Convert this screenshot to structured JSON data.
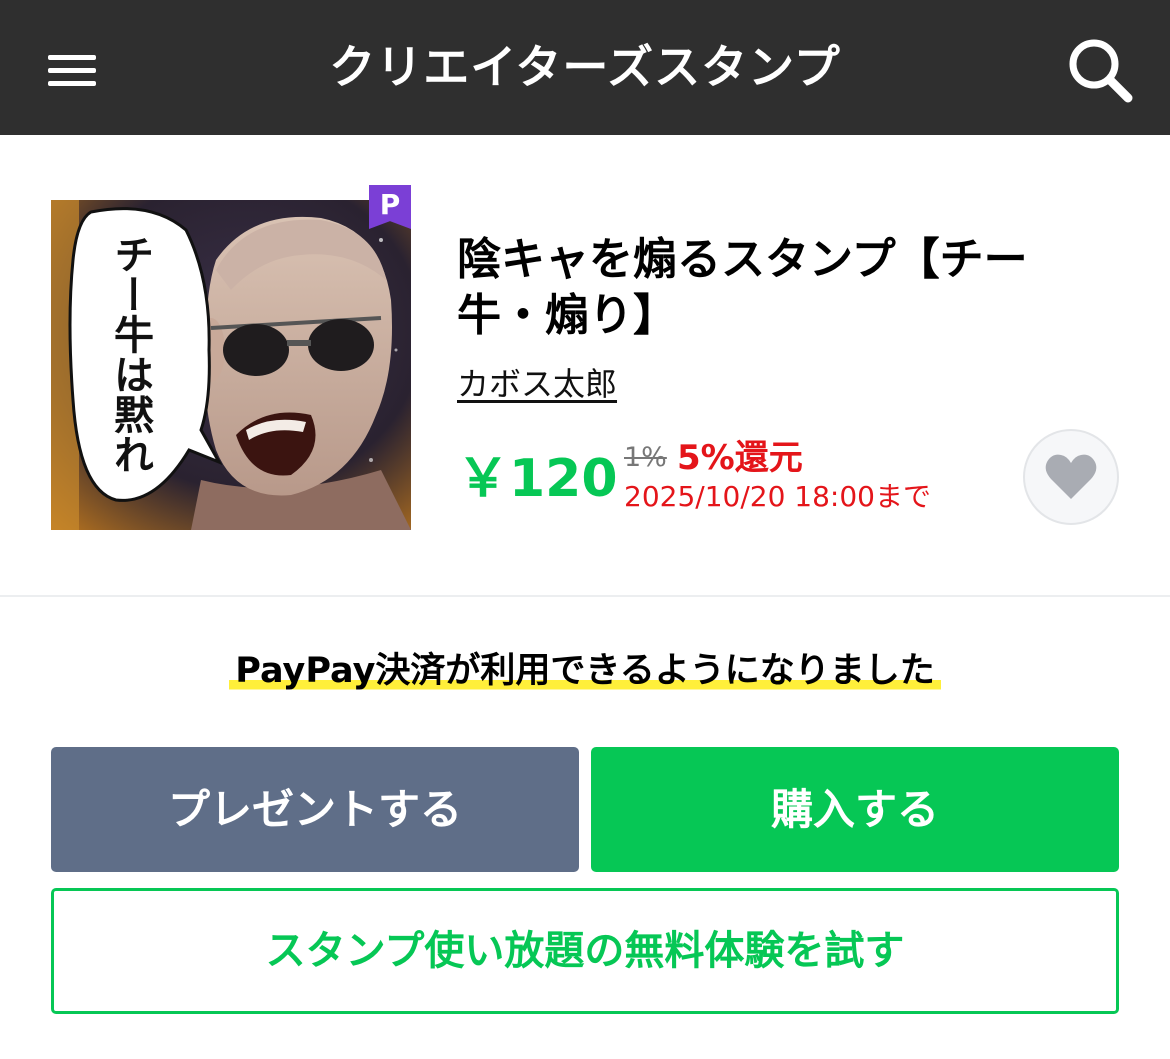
{
  "header": {
    "title": "クリエイターズスタンプ",
    "menu_icon": "hamburger-menu-icon",
    "search_icon": "search-icon"
  },
  "product": {
    "badge": "P",
    "title": "陰キャを煽るスタンプ【チー牛・煽り】",
    "author": "カボス太郎",
    "price": "￥120",
    "old_rate": "1%",
    "new_rate": "5%還元",
    "deadline": "2025/10/20 18:00まで",
    "thumbnail_text": "チー牛は黙れ",
    "favorite_icon": "heart-icon"
  },
  "notice": "PayPay決済が利用できるようになりました",
  "buttons": {
    "present": "プレゼントする",
    "buy": "購入する",
    "trial": "スタンプ使い放題の無料体験を試す"
  },
  "colors": {
    "header_bg": "#2f2f2f",
    "line_green": "#06c755",
    "present_btn": "#5f6e88",
    "sale_red": "#e4151a",
    "premium_purple": "#7b3fd6",
    "highlight_yellow": "#ffef3a"
  }
}
